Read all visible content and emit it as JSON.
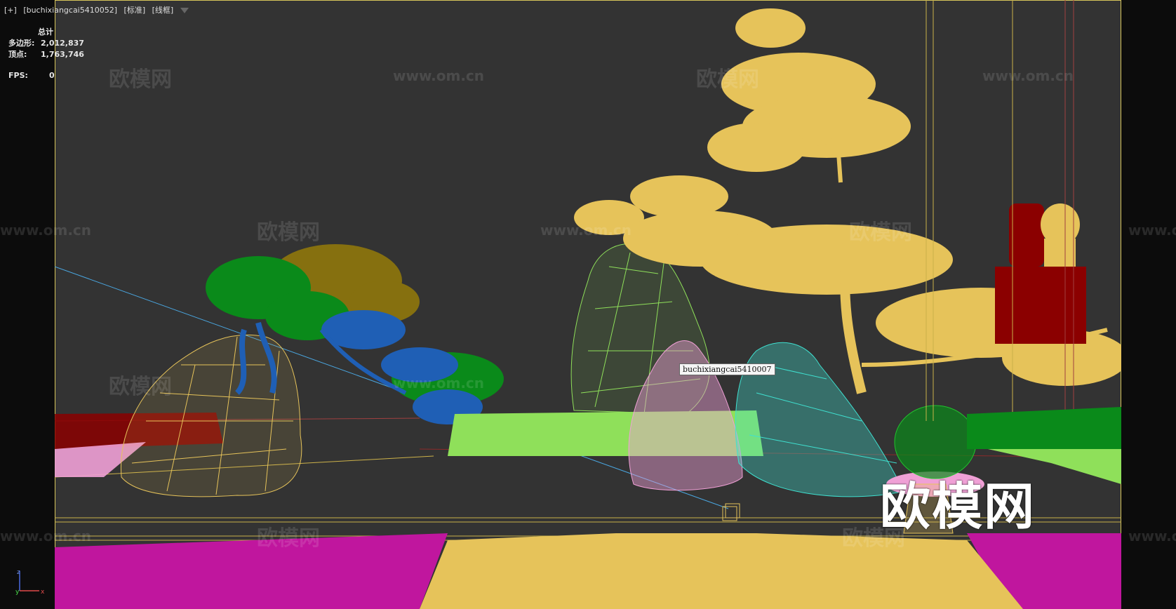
{
  "viewport": {
    "label_plus": "[+]",
    "label_object": "[buchixiangcai5410052]",
    "label_shading": "[标准]",
    "label_mode": "[线框]",
    "filter_icon": "filter-icon"
  },
  "stats": {
    "total_label": "总计",
    "polygons_label": "多边形:",
    "polygons_value": "2,012,837",
    "vertices_label": "顶点:",
    "vertices_value": "1,763,746",
    "fps_label": "FPS:",
    "fps_value": "0"
  },
  "tooltip": {
    "text": "buchixiangcai5410007"
  },
  "watermark": {
    "cn": "欧模网",
    "url": "www.om.cn"
  },
  "logo": {
    "text": "欧模网"
  },
  "axis": {
    "z": "z",
    "y": "y",
    "x": "x"
  },
  "colors": {
    "viewport_bg": "#333333",
    "frame_border": "#d6c55a",
    "pine_yellow": "#e6c35a",
    "green": "#0a8a1a",
    "blue": "#1f5fb5",
    "lime": "#8fe05a",
    "cyan": "#3fe0d0",
    "pink": "#f0a0d6",
    "magenta": "#c0169e",
    "red": "#8b0000"
  }
}
